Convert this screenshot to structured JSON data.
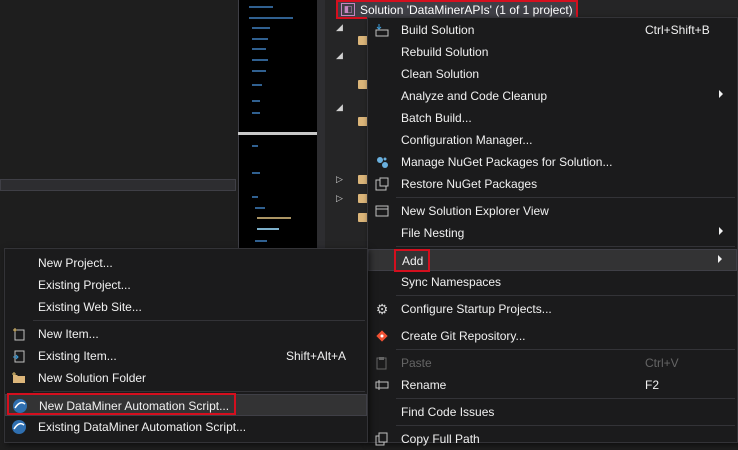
{
  "solution_explorer": {
    "solution_label": "Solution 'DataMinerAPIs' (1 of 1 project)"
  },
  "main_menu": {
    "items": [
      {
        "label": "Build Solution",
        "shortcut": "Ctrl+Shift+B",
        "icon": "build-icon"
      },
      {
        "label": "Rebuild Solution"
      },
      {
        "label": "Clean Solution"
      },
      {
        "label": "Analyze and Code Cleanup",
        "submenu": true
      },
      {
        "label": "Batch Build..."
      },
      {
        "label": "Configuration Manager..."
      },
      {
        "label": "Manage NuGet Packages for Solution...",
        "icon": "nuget-icon"
      },
      {
        "label": "Restore NuGet Packages",
        "icon": "restore-icon"
      },
      {
        "label": "New Solution Explorer View",
        "icon": "explorer-view-icon"
      },
      {
        "label": "File Nesting",
        "submenu": true
      },
      {
        "label": "Add",
        "submenu": true
      },
      {
        "label": "Sync Namespaces"
      },
      {
        "label": "Configure Startup Projects...",
        "icon": "gear-icon"
      },
      {
        "label": "Create Git Repository...",
        "icon": "git-icon"
      },
      {
        "label": "Paste",
        "shortcut": "Ctrl+V",
        "disabled": true,
        "icon": "paste-icon"
      },
      {
        "label": "Rename",
        "shortcut": "F2",
        "icon": "rename-icon"
      },
      {
        "label": "Find Code Issues"
      },
      {
        "label": "Copy Full Path",
        "icon": "copy-icon"
      }
    ]
  },
  "add_menu": {
    "items": [
      {
        "label": "New Project..."
      },
      {
        "label": "Existing Project..."
      },
      {
        "label": "Existing Web Site..."
      },
      {
        "label": "New Item...",
        "icon": "new-item-icon"
      },
      {
        "label": "Existing Item...",
        "shortcut": "Shift+Alt+A",
        "icon": "existing-item-icon"
      },
      {
        "label": "New Solution Folder",
        "icon": "folder-icon"
      },
      {
        "label": "New DataMiner Automation Script...",
        "icon": "dataminer-icon"
      },
      {
        "label": "Existing DataMiner Automation Script...",
        "icon": "dataminer-icon"
      }
    ]
  },
  "colors": {
    "highlight_box": "#d40f1e",
    "menu_bg": "#1b1b1c",
    "menu_text": "#f1f1f1",
    "disabled_text": "#656565"
  }
}
